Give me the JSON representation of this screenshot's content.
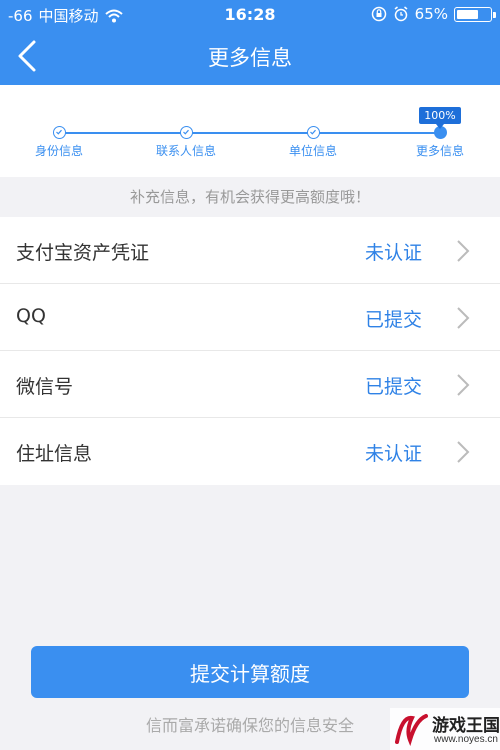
{
  "status_bar": {
    "signal": "-66",
    "carrier": "中国移动",
    "time": "16:28",
    "battery": "65%",
    "battery_level": 0.65
  },
  "nav": {
    "title": "更多信息",
    "back_icon": "chevron-left-icon"
  },
  "progress": {
    "percent_label": "100%",
    "steps": [
      {
        "label": "身份信息"
      },
      {
        "label": "联系人信息"
      },
      {
        "label": "单位信息"
      },
      {
        "label": "更多信息"
      }
    ]
  },
  "hint": "补充信息，有机会获得更高额度哦！",
  "items": [
    {
      "label": "支付宝资产凭证",
      "status": "未认证"
    },
    {
      "label": "QQ",
      "status": "已提交"
    },
    {
      "label": "微信号",
      "status": "已提交"
    },
    {
      "label": "住址信息",
      "status": "未认证"
    }
  ],
  "submit_label": "提交计算额度",
  "footer_note": "信而富承诺确保您的信息安全",
  "watermark": {
    "text": "游戏王国",
    "url": "www.noyes.cn"
  },
  "colors": {
    "primary": "#3a8ff0",
    "status_text": "#2f82e6",
    "background": "#f2f2f5"
  }
}
